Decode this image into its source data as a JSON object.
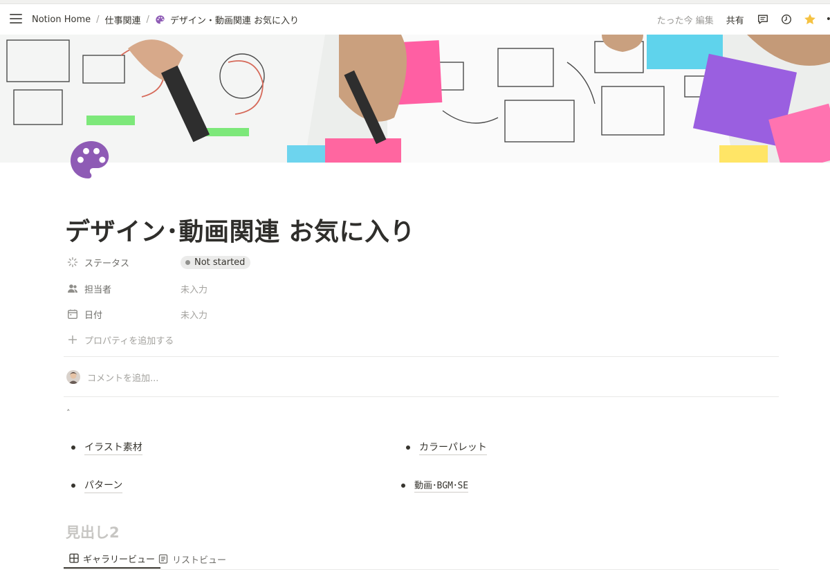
{
  "topbar": {
    "breadcrumbs": [
      "Notion Home",
      "仕事関連",
      "デザイン・動画関連 お気に入り"
    ],
    "edited": "たった今 編集",
    "share": "共有",
    "more": "•"
  },
  "page": {
    "title": "デザイン･動画関連 お気に入り",
    "properties": [
      {
        "label": "ステータス",
        "value": "Not started"
      },
      {
        "label": "担当者",
        "value": "未入力"
      },
      {
        "label": "日付",
        "value": "未入力"
      }
    ],
    "add_property": "プロパティを追加する",
    "comment_placeholder": "コメントを追加...",
    "caret": "˄",
    "links": [
      "イラスト素材",
      "カラーパレット",
      "パターン",
      "動画･BGM･SE"
    ],
    "heading2": "見出し2",
    "tabs": [
      "ギャラリービュー",
      "リストビュー"
    ]
  },
  "colors": {
    "palette_icon": "#8e5bb5",
    "star": "#f5c242",
    "status_dot": "#91918e"
  }
}
